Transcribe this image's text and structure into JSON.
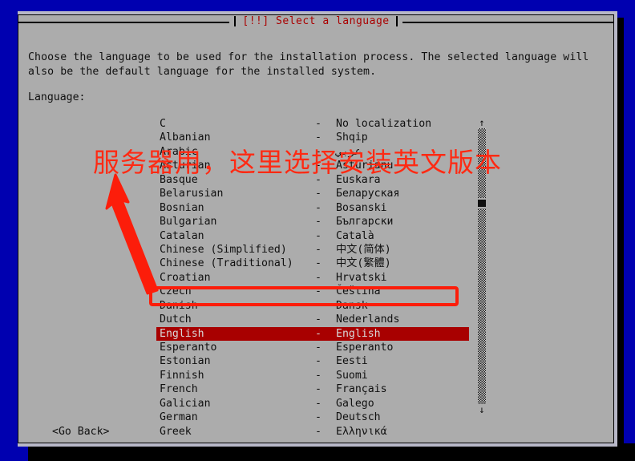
{
  "window": {
    "title": "[!!] Select a language"
  },
  "body": {
    "intro": "Choose the language to be used for the installation process. The selected language will\nalso be the default language for the installed system.",
    "language_label": "Language:"
  },
  "list": {
    "separator": "-",
    "items": [
      {
        "name": "C",
        "native": "No localization",
        "selected": false
      },
      {
        "name": "Albanian",
        "native": "Shqip",
        "selected": false
      },
      {
        "name": "Arabic",
        "native": "عربي",
        "selected": false
      },
      {
        "name": "Asturian",
        "native": "Asturianu",
        "selected": false
      },
      {
        "name": "Basque",
        "native": "Euskara",
        "selected": false
      },
      {
        "name": "Belarusian",
        "native": "Беларуская",
        "selected": false
      },
      {
        "name": "Bosnian",
        "native": "Bosanski",
        "selected": false
      },
      {
        "name": "Bulgarian",
        "native": "Български",
        "selected": false
      },
      {
        "name": "Catalan",
        "native": "Català",
        "selected": false
      },
      {
        "name": "Chinese (Simplified)",
        "native": "中文(简体)",
        "selected": false
      },
      {
        "name": "Chinese (Traditional)",
        "native": "中文(繁體)",
        "selected": false
      },
      {
        "name": "Croatian",
        "native": "Hrvatski",
        "selected": false
      },
      {
        "name": "Czech",
        "native": "Čeština",
        "selected": false
      },
      {
        "name": "Danish",
        "native": "Dansk",
        "selected": false
      },
      {
        "name": "Dutch",
        "native": "Nederlands",
        "selected": false
      },
      {
        "name": "English",
        "native": "English",
        "selected": true
      },
      {
        "name": "Esperanto",
        "native": "Esperanto",
        "selected": false
      },
      {
        "name": "Estonian",
        "native": "Eesti",
        "selected": false
      },
      {
        "name": "Finnish",
        "native": "Suomi",
        "selected": false
      },
      {
        "name": "French",
        "native": "Français",
        "selected": false
      },
      {
        "name": "Galician",
        "native": "Galego",
        "selected": false
      },
      {
        "name": "German",
        "native": "Deutsch",
        "selected": false
      },
      {
        "name": "Greek",
        "native": "Ελληνικά",
        "selected": false
      }
    ]
  },
  "scrollbar": {
    "up_arrow": "↑",
    "down_arrow": "↓"
  },
  "footer": {
    "go_back": "<Go Back>"
  },
  "annotations": {
    "note_text": "服务器用，这里选择安装英文版本",
    "note_color": "#ff2a13",
    "highlight_color": "#fc1d0a"
  },
  "colors": {
    "desktop_blue": "#0000b0",
    "dialog_gray": "#acacac",
    "title_red": "#aa0000",
    "selection_red": "#a80000",
    "text_black": "#101010"
  }
}
